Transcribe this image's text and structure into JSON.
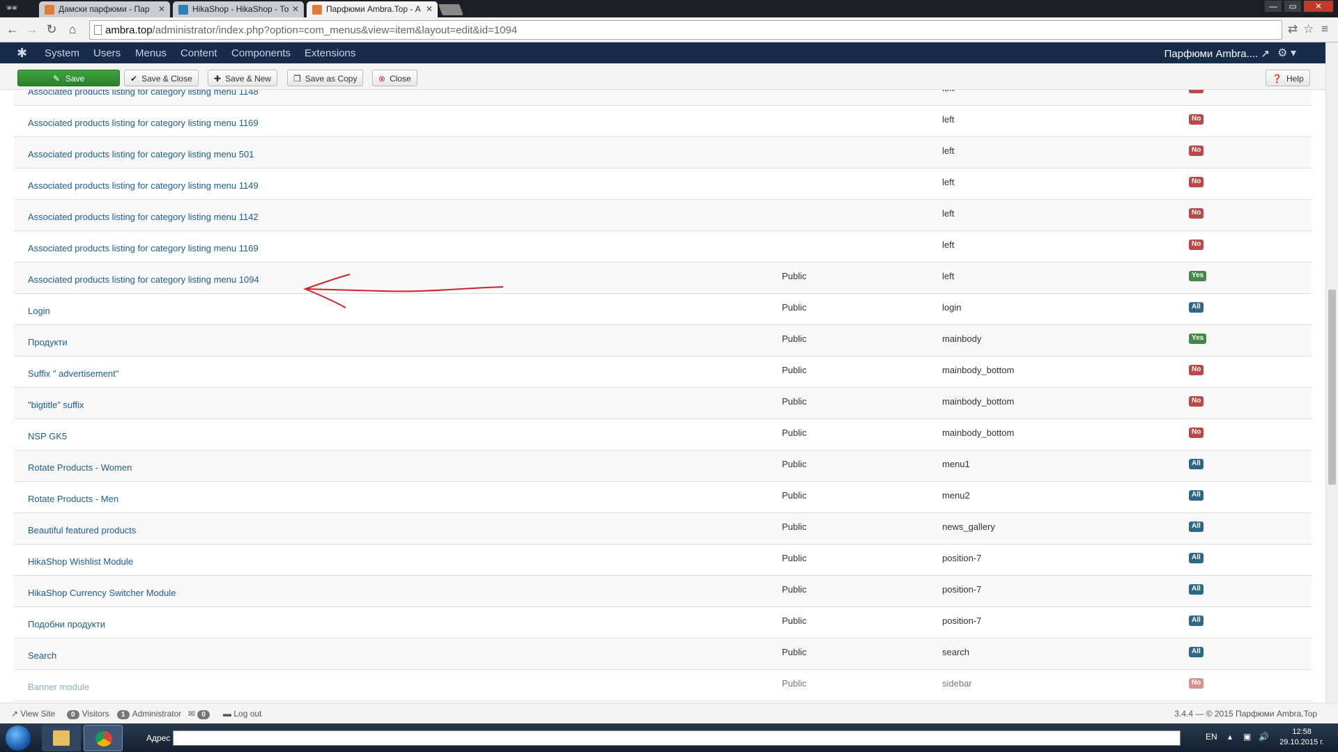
{
  "browser": {
    "tabs": [
      {
        "label": "Дамски парфюми - Пар",
        "color": "#e07b39",
        "active": false
      },
      {
        "label": "HikaShop - HikaShop - То",
        "color": "#2f7fb8",
        "active": false
      },
      {
        "label": "Парфюми Ambra.Top - А",
        "color": "#e07b39",
        "active": true
      }
    ],
    "url_host": "ambra.top",
    "url_path": "/administrator/index.php?option=com_menus&view=item&layout=edit&id=1094",
    "window_controls": [
      "—",
      "▭",
      "✕"
    ]
  },
  "joomla_nav": {
    "items": [
      "System",
      "Users",
      "Menus",
      "Content",
      "Components",
      "Extensions"
    ],
    "site_name": "Парфюми Ambra....",
    "site_icon": "↗"
  },
  "toolbar": {
    "save": "Save",
    "save_close": "Save & Close",
    "save_new": "Save & New",
    "save_copy": "Save as Copy",
    "close": "Close",
    "help": "Help"
  },
  "modules": [
    {
      "title": "Associated products listing for category listing menu 1148",
      "access": "",
      "position": "left",
      "status": "No",
      "kind": "no"
    },
    {
      "title": "Associated products listing for category listing menu 1169",
      "access": "",
      "position": "left",
      "status": "No",
      "kind": "no"
    },
    {
      "title": "Associated products listing for category listing menu 501",
      "access": "",
      "position": "left",
      "status": "No",
      "kind": "no"
    },
    {
      "title": "Associated products listing for category listing menu 1149",
      "access": "",
      "position": "left",
      "status": "No",
      "kind": "no"
    },
    {
      "title": "Associated products listing for category listing menu 1142",
      "access": "",
      "position": "left",
      "status": "No",
      "kind": "no"
    },
    {
      "title": "Associated products listing for category listing menu 1169",
      "access": "",
      "position": "left",
      "status": "No",
      "kind": "no"
    },
    {
      "title": "Associated products listing for category listing menu 1094",
      "access": "Public",
      "position": "left",
      "status": "Yes",
      "kind": "yes"
    },
    {
      "title": "Login",
      "access": "Public",
      "position": "login",
      "status": "All",
      "kind": "all"
    },
    {
      "title": "Продукти",
      "access": "Public",
      "position": "mainbody",
      "status": "Yes",
      "kind": "yes"
    },
    {
      "title": "Suffix \" advertisement\"",
      "access": "Public",
      "position": "mainbody_bottom",
      "status": "No",
      "kind": "no"
    },
    {
      "title": "\"bigtitle\" suffix",
      "access": "Public",
      "position": "mainbody_bottom",
      "status": "No",
      "kind": "no"
    },
    {
      "title": "NSP GK5",
      "access": "Public",
      "position": "mainbody_bottom",
      "status": "No",
      "kind": "no"
    },
    {
      "title": "Rotate Products - Women",
      "access": "Public",
      "position": "menu1",
      "status": "All",
      "kind": "all"
    },
    {
      "title": "Rotate Products - Men",
      "access": "Public",
      "position": "menu2",
      "status": "All",
      "kind": "all"
    },
    {
      "title": "Beautiful featured products",
      "access": "Public",
      "position": "news_gallery",
      "status": "All",
      "kind": "all"
    },
    {
      "title": "HikaShop Wishlist Module",
      "access": "Public",
      "position": "position-7",
      "status": "All",
      "kind": "all"
    },
    {
      "title": "HikaShop Currency Switcher Module",
      "access": "Public",
      "position": "position-7",
      "status": "All",
      "kind": "all"
    },
    {
      "title": "Подобни продукти",
      "access": "Public",
      "position": "position-7",
      "status": "All",
      "kind": "all"
    },
    {
      "title": "Search",
      "access": "Public",
      "position": "search",
      "status": "All",
      "kind": "all"
    },
    {
      "title": "Banner module",
      "access": "Public",
      "position": "sidebar",
      "status": "No",
      "kind": "no",
      "faded": true
    }
  ],
  "statusbar": {
    "view_site": "View Site",
    "visitors_count": "0",
    "visitors": "Visitors",
    "admin_count": "1",
    "admin": "Administrator",
    "messages_count": "0",
    "logout": "Log out",
    "version": "3.4.4 — © 2015 Парфюми Ambra.Top"
  },
  "taskbar": {
    "address_label": "Адрес",
    "lang": "EN",
    "time": "12:58",
    "date": "29.10.2015 г."
  },
  "colors": {
    "badge_no": "#b94a48",
    "badge_yes": "#468847",
    "badge_all": "#2d6987",
    "save_green": "#2b7f2c",
    "nav_bg": "#172c4b",
    "annotation_red": "#d0202a"
  }
}
